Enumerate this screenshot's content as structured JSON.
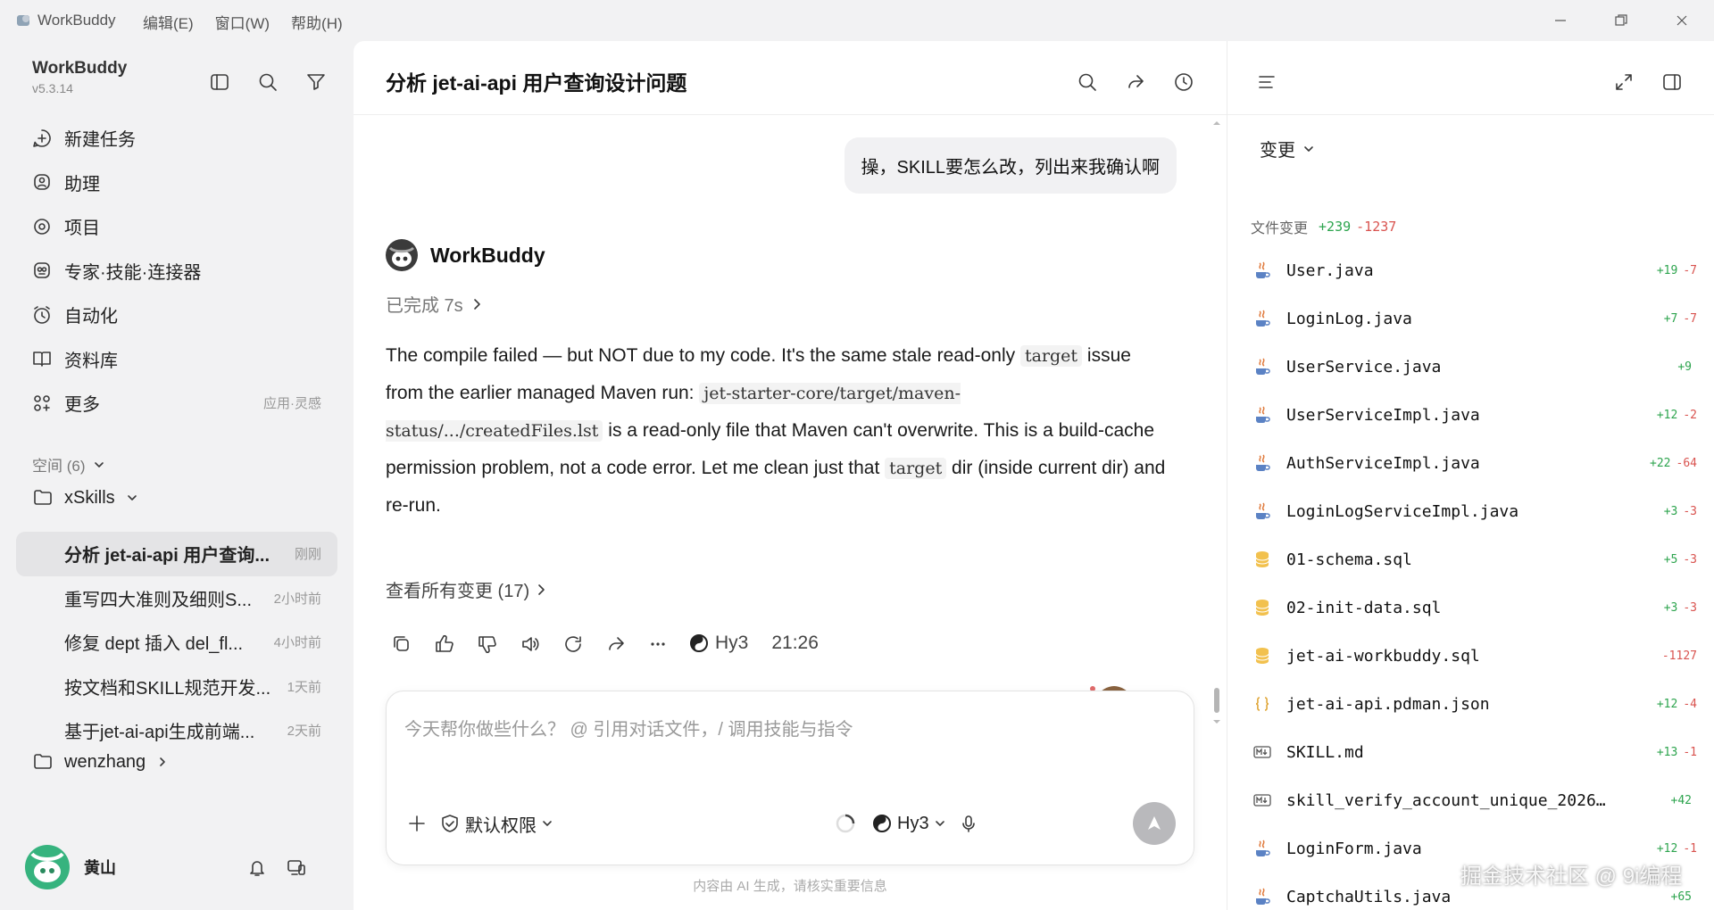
{
  "titlebar": {
    "app_name": "WorkBuddy",
    "menus": [
      "编辑(E)",
      "窗口(W)",
      "帮助(H)"
    ]
  },
  "sidebar": {
    "brand": "WorkBuddy",
    "version": "v5.3.14",
    "nav": [
      {
        "label": "新建任务",
        "icon": "new-task-icon",
        "hint": ""
      },
      {
        "label": "助理",
        "icon": "assistant-icon",
        "hint": ""
      },
      {
        "label": "项目",
        "icon": "project-icon",
        "hint": ""
      },
      {
        "label": "专家·技能·连接器",
        "icon": "expert-icon",
        "hint": ""
      },
      {
        "label": "自动化",
        "icon": "automation-icon",
        "hint": ""
      },
      {
        "label": "资料库",
        "icon": "library-icon",
        "hint": ""
      },
      {
        "label": "更多",
        "icon": "more-icon",
        "hint": "应用·灵感"
      }
    ],
    "spaces_label": "空间 (6)",
    "folder_xskills": "xSkills",
    "tasks": [
      {
        "title": "分析 jet-ai-api 用户查询...",
        "time": "刚刚",
        "active": true
      },
      {
        "title": "重写四大准则及细则S...",
        "time": "2小时前",
        "active": false
      },
      {
        "title": "修复 dept 插入 del_fl...",
        "time": "4小时前",
        "active": false
      },
      {
        "title": "按文档和SKILL规范开发...",
        "time": "1天前",
        "active": false
      },
      {
        "title": "基于jet-ai-api生成前端...",
        "time": "2天前",
        "active": false
      }
    ],
    "folder_wenzhang": "wenzhang",
    "user_name": "黄山"
  },
  "chat": {
    "title": "分析 jet-ai-api 用户查询设计问题",
    "user_message": "操，SKILL要怎么改，列出来我确认啊",
    "bot_name": "WorkBuddy",
    "status": "已完成 7s",
    "body": {
      "p1": "The compile failed — but NOT due to my code. It's the same stale read-only ",
      "c1": "target",
      "p2": " issue from the earlier managed Maven run: ",
      "c2": "jet-starter-core/target/maven-status/.../createdFiles.lst",
      "p3": " is a read-only file that Maven can't overwrite. This is a build-cache permission problem, not a code error. Let me clean just that ",
      "c3": "target",
      "p4": " dir (inside current dir) and re-run."
    },
    "view_all": "查看所有变更 (17)",
    "model": "Hy3",
    "time": "21:26",
    "input_placeholder": "今天帮你做些什么？ @ 引用对话文件，/ 调用技能与指令",
    "permission": "默认权限",
    "input_model": "Hy3",
    "disclaimer": "内容由 AI 生成，请核实重要信息"
  },
  "changes": {
    "dropdown": "变更",
    "header": "文件变更",
    "total_add": "+239",
    "total_del": "-1237",
    "files": [
      {
        "name": "User.java",
        "icon": "java-file-icon",
        "add": "+19",
        "del": "-7"
      },
      {
        "name": "LoginLog.java",
        "icon": "java-file-icon",
        "add": "+7",
        "del": "-7"
      },
      {
        "name": "UserService.java",
        "icon": "java-file-icon",
        "add": "+9",
        "del": ""
      },
      {
        "name": "UserServiceImpl.java",
        "icon": "java-file-icon",
        "add": "+12",
        "del": "-2"
      },
      {
        "name": "AuthServiceImpl.java",
        "icon": "java-file-icon",
        "add": "+22",
        "del": "-64"
      },
      {
        "name": "LoginLogServiceImpl.java",
        "icon": "java-file-icon",
        "add": "+3",
        "del": "-3"
      },
      {
        "name": "01-schema.sql",
        "icon": "sql-file-icon",
        "add": "+5",
        "del": "-3"
      },
      {
        "name": "02-init-data.sql",
        "icon": "sql-file-icon",
        "add": "+3",
        "del": "-3"
      },
      {
        "name": "jet-ai-workbuddy.sql",
        "icon": "sql-file-icon",
        "add": "",
        "del": "-1127"
      },
      {
        "name": "jet-ai-api.pdman.json",
        "icon": "json-file-icon",
        "add": "+12",
        "del": "-4"
      },
      {
        "name": "SKILL.md",
        "icon": "markdown-file-icon",
        "add": "+13",
        "del": "-1"
      },
      {
        "name": "skill_verify_account_unique_2026…",
        "icon": "markdown-file-icon",
        "add": "+42",
        "del": ""
      },
      {
        "name": "LoginForm.java",
        "icon": "java-file-icon",
        "add": "+12",
        "del": "-1"
      },
      {
        "name": "CaptchaUtils.java",
        "icon": "java-file-icon",
        "add": "+65",
        "del": ""
      }
    ]
  },
  "watermark": "掘金技术社区 @ 9i编程",
  "colors": {
    "add": "#2da44e",
    "del": "#d9534f",
    "active_task_bg": "#e4e4e6",
    "send_button": "#b9b9bc"
  }
}
